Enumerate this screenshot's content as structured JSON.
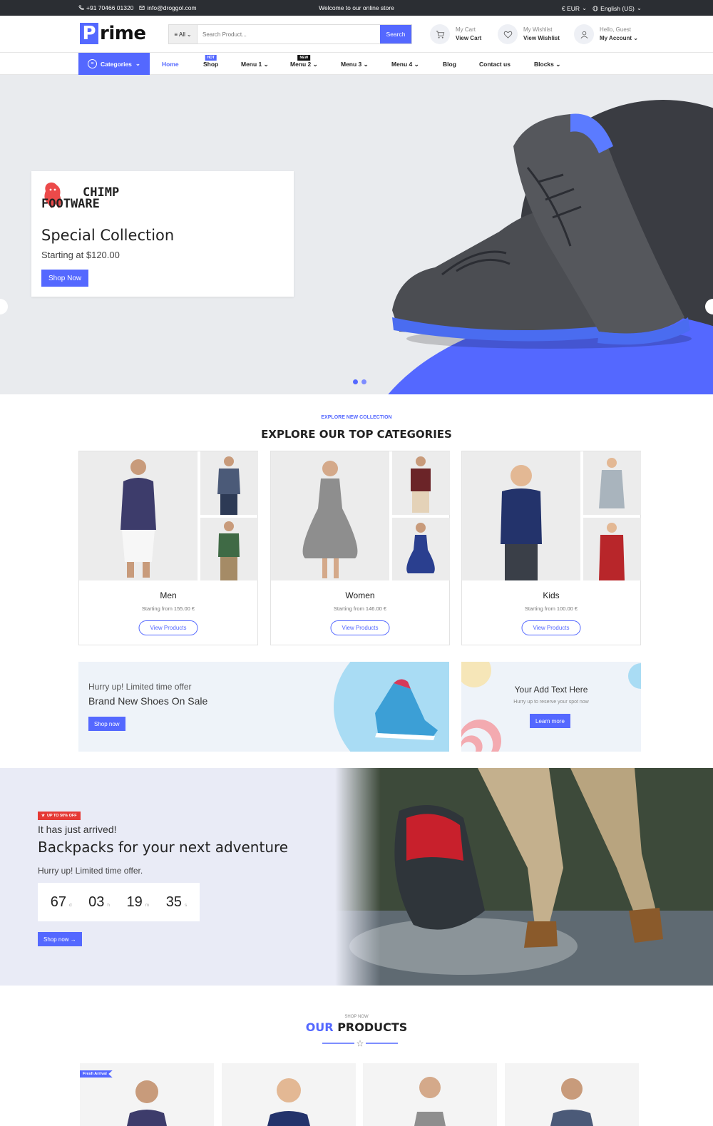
{
  "topbar": {
    "phone": "+91 70466 01320",
    "email": "info@droggol.com",
    "welcome": "Welcome to our online store",
    "currency": "€ EUR",
    "language": "English (US)"
  },
  "header": {
    "logo_letter": "P",
    "logo_rest": "rime",
    "search_category": "All",
    "search_placeholder": "Search Product...",
    "search_button": "Search",
    "cart_top": "My Cart",
    "cart_bottom": "View Cart",
    "wishlist_top": "My Wishlist",
    "wishlist_bottom": "View Wishlist",
    "account_top": "Hello, Guest",
    "account_bottom": "My Account"
  },
  "nav": {
    "categories": "Categories",
    "items": [
      "Home",
      "Shop",
      "Menu 1",
      "Menu 2",
      "Menu 3",
      "Menu 4",
      "Blog",
      "Contact us",
      "Blocks"
    ],
    "badge_hot": "HOT",
    "badge_new": "NEW"
  },
  "hero": {
    "brand_line1": "CHIMP",
    "brand_line2": "FOOTWARE",
    "title": "Special Collection",
    "subtitle": "Starting at $120.00",
    "button": "Shop Now"
  },
  "categories_section": {
    "eyebrow": "EXPLORE NEW COLLECTION",
    "title": "EXPLORE OUR TOP CATEGORIES",
    "cards": [
      {
        "name": "Men",
        "price": "Starting from 155.00 €",
        "button": "View Products"
      },
      {
        "name": "Women",
        "price": "Starting from 146.00 €",
        "button": "View Products"
      },
      {
        "name": "Kids",
        "price": "Starting from 100.00 €",
        "button": "View Products"
      }
    ]
  },
  "promo1": {
    "small": "Hurry up! Limited time offer",
    "big": "Brand New Shoes On Sale",
    "button": "Shop now"
  },
  "promo2": {
    "title": "Your Add Text Here",
    "sub": "Hurry up to reserve your spot now",
    "button": "Learn more"
  },
  "backpack": {
    "badge": "UP TO 50% OFF",
    "arrived": "It has just arrived!",
    "title": "Backpacks for your next adventure",
    "hurry": "Hurry up! Limited time offer.",
    "countdown": {
      "days": "67",
      "days_label": "d",
      "hours": "03",
      "hours_label": "h",
      "minutes": "19",
      "minutes_label": "m",
      "seconds": "35",
      "seconds_label": "s"
    },
    "button": "Shop now →"
  },
  "products": {
    "eyebrow": "SHOP NOW",
    "title_blue": "OUR",
    "title_rest": " PRODUCTS",
    "fresh_badge": "Fresh Arrival"
  },
  "colors": {
    "accent": "#5468ff",
    "topbar": "#2b2e33",
    "sale": "#e53935"
  }
}
